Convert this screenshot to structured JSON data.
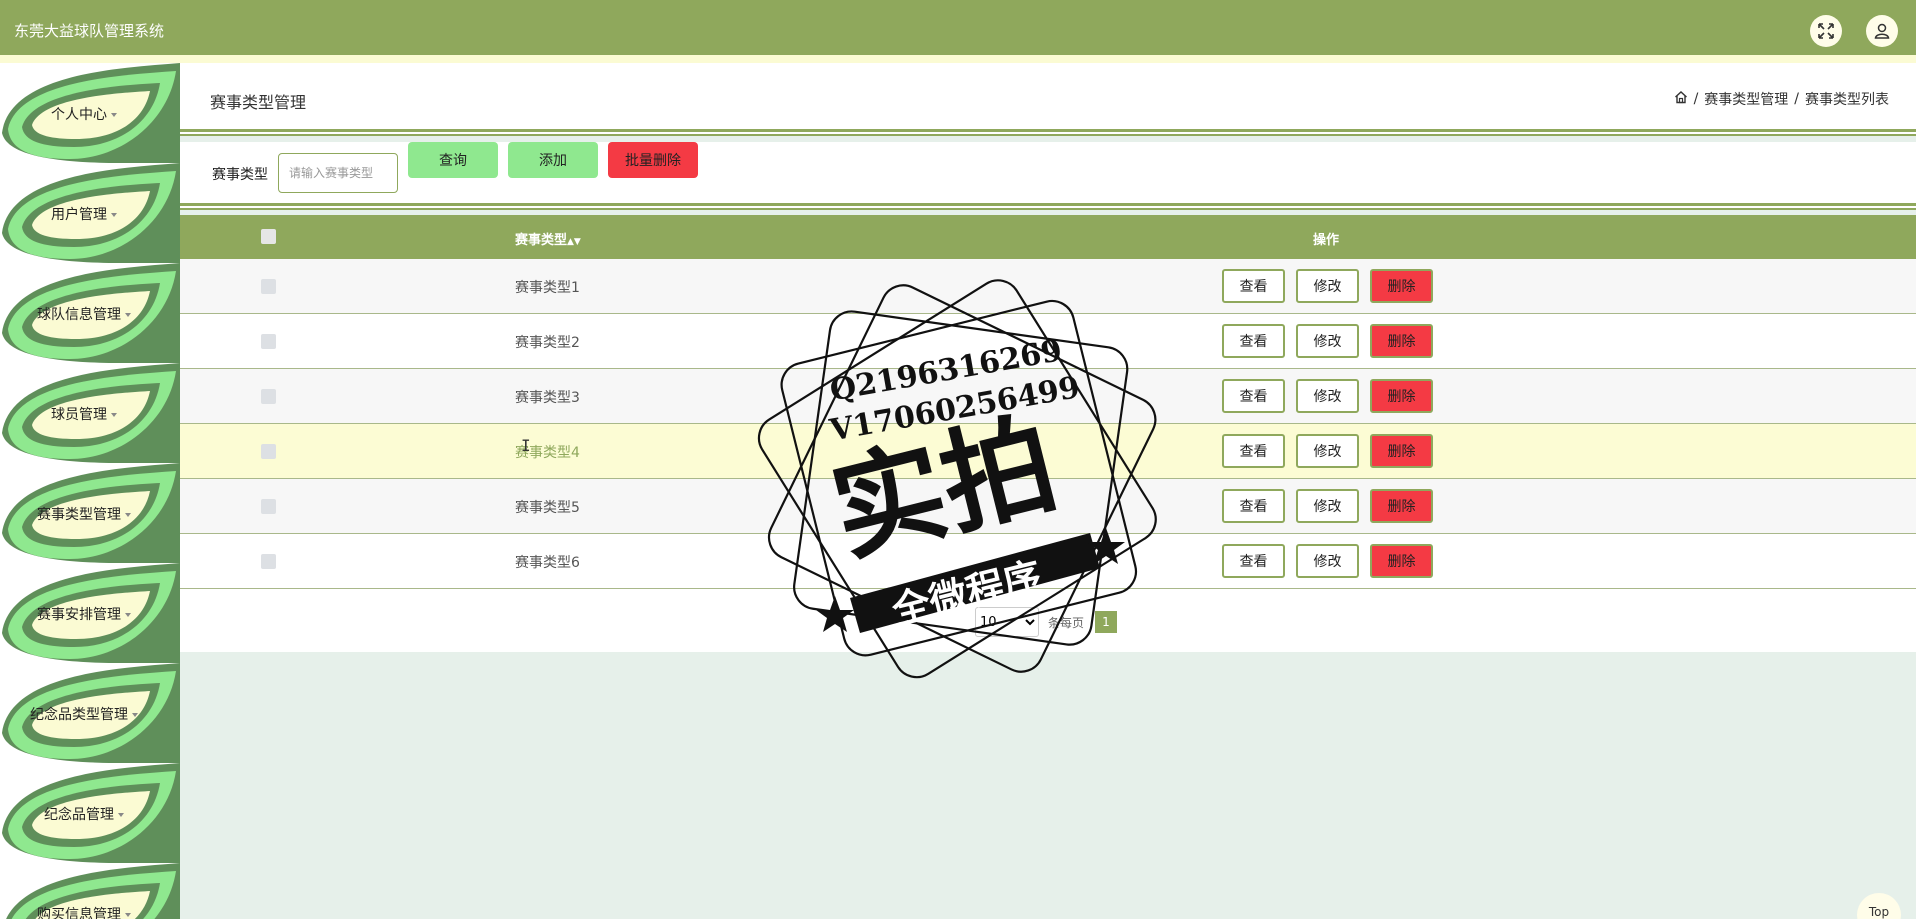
{
  "app": {
    "title": "东莞大益球队管理系统"
  },
  "header_icons": [
    "fullscreen-icon",
    "user-icon"
  ],
  "sidebar": {
    "items": [
      {
        "label": "个人中心"
      },
      {
        "label": "用户管理"
      },
      {
        "label": "球队信息管理"
      },
      {
        "label": "球员管理"
      },
      {
        "label": "赛事类型管理"
      },
      {
        "label": "赛事安排管理"
      },
      {
        "label": "纪念品类型管理"
      },
      {
        "label": "纪念品管理"
      },
      {
        "label": "购买信息管理"
      }
    ]
  },
  "page": {
    "title": "赛事类型管理",
    "breadcrumb": [
      "赛事类型管理",
      "赛事类型列表"
    ],
    "breadcrumb_sep": "/"
  },
  "search": {
    "label": "赛事类型",
    "placeholder": "请输入赛事类型",
    "query_label": "查询",
    "add_label": "添加",
    "batch_delete_label": "批量删除"
  },
  "table": {
    "headers": {
      "name": "赛事类型",
      "actions": "操作"
    },
    "rows": [
      {
        "name": "赛事类型1"
      },
      {
        "name": "赛事类型2"
      },
      {
        "name": "赛事类型3"
      },
      {
        "name": "赛事类型4"
      },
      {
        "name": "赛事类型5"
      },
      {
        "name": "赛事类型6"
      }
    ],
    "actions": {
      "view": "查看",
      "edit": "修改",
      "delete": "删除"
    }
  },
  "pagination": {
    "page_size": "10",
    "page_size_label": "条每页",
    "current_page": "1"
  },
  "scroll_top": {
    "label": "Top"
  },
  "watermark": {
    "line1": "Q2196316269",
    "line2": "V17060256499",
    "big": "实拍",
    "banner": "全微程序"
  },
  "colors": {
    "primary": "#8fa85c",
    "accent_green": "#8fe88f",
    "danger": "#f43a44",
    "highlight": "#fcfcd4"
  }
}
